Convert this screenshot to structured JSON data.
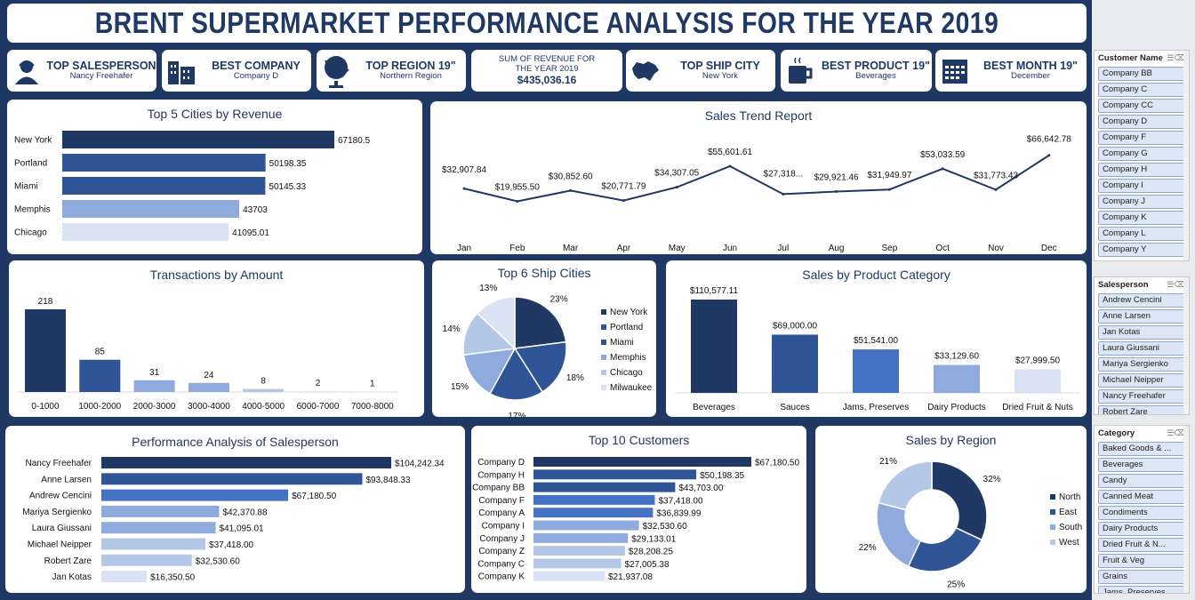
{
  "title": "BRENT SUPERMARKET PERFORMANCE ANALYSIS FOR THE YEAR 2019",
  "kpis": [
    {
      "label": "TOP SALESPERSON",
      "value": "Nancy Freehafer",
      "icon": "salesperson-icon"
    },
    {
      "label": "BEST COMPANY",
      "value": "Company D",
      "icon": "building-icon"
    },
    {
      "label": "TOP REGION 19\"",
      "value": "Northern Region",
      "icon": "globe-icon"
    },
    {
      "label": "SUM OF REVENUE FOR THE YEAR 2019",
      "value": "$435,036.16"
    },
    {
      "label": "TOP SHIP CITY",
      "value": "New York",
      "icon": "map-icon"
    },
    {
      "label": "BEST PRODUCT 19\"",
      "value": "Beverages",
      "icon": "cup-icon"
    },
    {
      "label": "BEST MONTH 19\"",
      "value": "December",
      "icon": "calendar-icon"
    }
  ],
  "colors": {
    "navy": "#1f3864",
    "dark": "#203864",
    "mid": "#2f5597",
    "blue": "#4472c4",
    "light": "#8faadc",
    "pale": "#b4c7e7",
    "faint": "#dae3f3"
  },
  "chart_data": [
    {
      "id": "top5cities",
      "type": "bar",
      "orientation": "horizontal",
      "title": "Top 5 Cities by Revenue",
      "categories": [
        "New York",
        "Portland",
        "Miami",
        "Memphis",
        "Chicago"
      ],
      "values": [
        67180.5,
        50198.35,
        50145.33,
        43703,
        41095.01
      ],
      "labels": [
        "67180.5",
        "50198.35",
        "50145.33",
        "43703",
        "41095.01"
      ]
    },
    {
      "id": "trend",
      "type": "line",
      "title": "Sales Trend Report",
      "categories": [
        "Jan",
        "Feb",
        "Mar",
        "Apr",
        "May",
        "Jun",
        "Jul",
        "Aug",
        "Sep",
        "Oct",
        "Nov",
        "Dec"
      ],
      "values": [
        32907.84,
        19955.5,
        30852.6,
        20771.79,
        34307.05,
        55601.61,
        27318,
        29921.46,
        31949.97,
        53033.59,
        31773.43,
        66642.78
      ],
      "labels": [
        "$32,907.84",
        "$19,955.50",
        "$30,852.60",
        "$20,771.79",
        "$34,307.05",
        "$55,601.61",
        "$27,318...",
        "$29,921.46",
        "$31,949.97",
        "$53,033.59",
        "$31,773.43",
        "$66,642.78"
      ]
    },
    {
      "id": "transactions",
      "type": "bar",
      "title": "Transactions by Amount",
      "categories": [
        "0-1000",
        "1000-2000",
        "2000-3000",
        "3000-4000",
        "4000-5000",
        "6000-7000",
        "7000-8000"
      ],
      "values": [
        218,
        85,
        31,
        24,
        8,
        2,
        1
      ],
      "labels": [
        "218",
        "85",
        "31",
        "24",
        "8",
        "2",
        "1"
      ]
    },
    {
      "id": "shipcities",
      "type": "pie",
      "title": "Top 6 Ship Cities",
      "categories": [
        "New York",
        "Portland",
        "Miami",
        "Memphis",
        "Chicago",
        "Milwaukee"
      ],
      "values": [
        23,
        18,
        17,
        15,
        14,
        13
      ],
      "labels": [
        "23%",
        "18%",
        "17%",
        "15%",
        "14%",
        "13%"
      ],
      "legend": "right"
    },
    {
      "id": "category",
      "type": "bar",
      "title": "Sales by Product Category",
      "categories": [
        "Beverages",
        "Sauces",
        "Jams, Preserves",
        "Dairy Products",
        "Dried Fruit & Nuts"
      ],
      "values": [
        110577.11,
        69000.0,
        51541.0,
        33129.6,
        27999.5
      ],
      "labels": [
        "$110,577.11",
        "$69,000.00",
        "$51,541.00",
        "$33,129.60",
        "$27,999.50"
      ]
    },
    {
      "id": "salesperson",
      "type": "bar",
      "orientation": "horizontal",
      "title": "Performance Analysis of Salesperson",
      "categories": [
        "Nancy Freehafer",
        "Anne Larsen",
        "Andrew Cencini",
        "Mariya Sergienko",
        "Laura Giussani",
        "Michael Neipper",
        "Robert Zare",
        "Jan Kotas"
      ],
      "values": [
        104242.34,
        93848.33,
        67180.5,
        42370.88,
        41095.01,
        37418.0,
        32530.6,
        16350.5
      ],
      "labels": [
        "$104,242.34",
        "$93,848.33",
        "$67,180.50",
        "$42,370.88",
        "$41,095.01",
        "$37,418.00",
        "$32,530.60",
        "$16,350.50"
      ]
    },
    {
      "id": "customers",
      "type": "bar",
      "orientation": "horizontal",
      "title": "Top 10 Customers",
      "categories": [
        "Company D",
        "Company H",
        "Company BB",
        "Company F",
        "Company A",
        "Company I",
        "Company J",
        "Company Z",
        "Company C",
        "Company K"
      ],
      "values": [
        67180.5,
        50198.35,
        43703.0,
        37418.0,
        36839.99,
        32530.6,
        29133.01,
        28208.25,
        27005.38,
        21937.08
      ],
      "labels": [
        "$67,180.50",
        "$50,198.35",
        "$43,703.00",
        "$37,418.00",
        "$36,839.99",
        "$32,530.60",
        "$29,133.01",
        "$28,208.25",
        "$27,005.38",
        "$21,937.08"
      ]
    },
    {
      "id": "region",
      "type": "pie",
      "subtype": "donut",
      "title": "Sales by Region",
      "categories": [
        "North",
        "East",
        "South",
        "West"
      ],
      "values": [
        32,
        25,
        22,
        21
      ],
      "labels": [
        "32%",
        "25%",
        "22%",
        "21%"
      ],
      "legend": "right"
    }
  ],
  "slicers": [
    {
      "title": "Customer Name",
      "items": [
        "Company BB",
        "Company C",
        "Company CC",
        "Company D",
        "Company F",
        "Company G",
        "Company H",
        "Company I",
        "Company J",
        "Company K",
        "Company L",
        "Company Y"
      ]
    },
    {
      "title": "Salesperson",
      "items": [
        "Andrew Cencini",
        "Anne Larsen",
        "Jan Kotas",
        "Laura Giussani",
        "Mariya Sergienko",
        "Michael Neipper",
        "Nancy Freehafer",
        "Robert Zare"
      ]
    },
    {
      "title": "Category",
      "items": [
        "Baked Goods & ...",
        "Beverages",
        "Candy",
        "Canned Meat",
        "Condiments",
        "Dairy Products",
        "Dried Fruit & N...",
        "Fruit & Veg",
        "Grains",
        "Jams, Preserves"
      ]
    }
  ]
}
